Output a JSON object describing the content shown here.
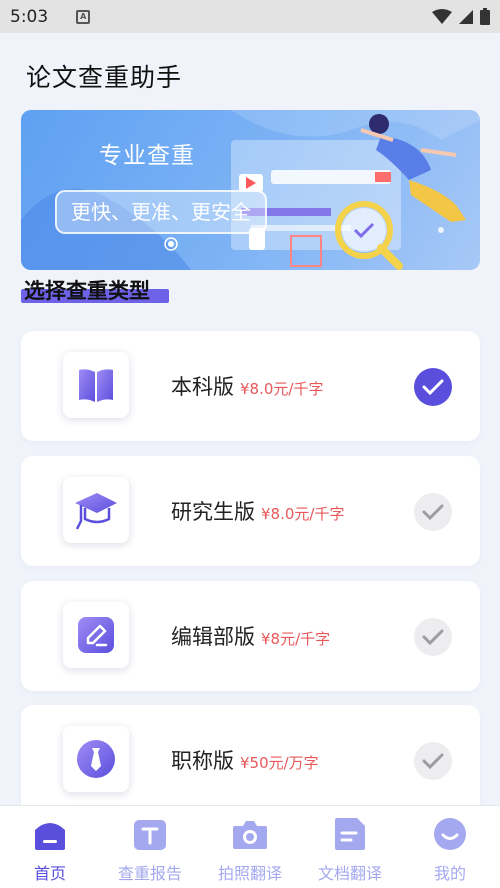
{
  "status": {
    "time": "5:03",
    "notif_glyph": "A"
  },
  "app": {
    "title": "论文查重助手"
  },
  "banner": {
    "title": "专业查重",
    "tagline": "更快、更准、更安全"
  },
  "section": {
    "title": "选择查重类型"
  },
  "cards": [
    {
      "name": "本科版",
      "price": "¥8.0元/千字",
      "selected": true,
      "icon": "open-book-icon"
    },
    {
      "name": "研究生版",
      "price": "¥8.0元/千字",
      "selected": false,
      "icon": "graduation-cap-icon"
    },
    {
      "name": "编辑部版",
      "price": "¥8元/千字",
      "selected": false,
      "icon": "pencil-edit-icon"
    },
    {
      "name": "职称版",
      "price": "¥50元/万字",
      "selected": false,
      "icon": "necktie-icon"
    }
  ],
  "tabs": [
    {
      "label": "首页",
      "icon": "home-icon",
      "active": true
    },
    {
      "label": "查重报告",
      "icon": "report-icon",
      "active": false
    },
    {
      "label": "拍照翻译",
      "icon": "camera-icon",
      "active": false
    },
    {
      "label": "文档翻译",
      "icon": "document-icon",
      "active": false
    },
    {
      "label": "我的",
      "icon": "smile-face-icon",
      "active": false
    }
  ],
  "colors": {
    "accent": "#5a4fdc",
    "price": "#e8585a",
    "tab_inactive": "#a3a8ef",
    "banner": "#6aa6f3"
  }
}
